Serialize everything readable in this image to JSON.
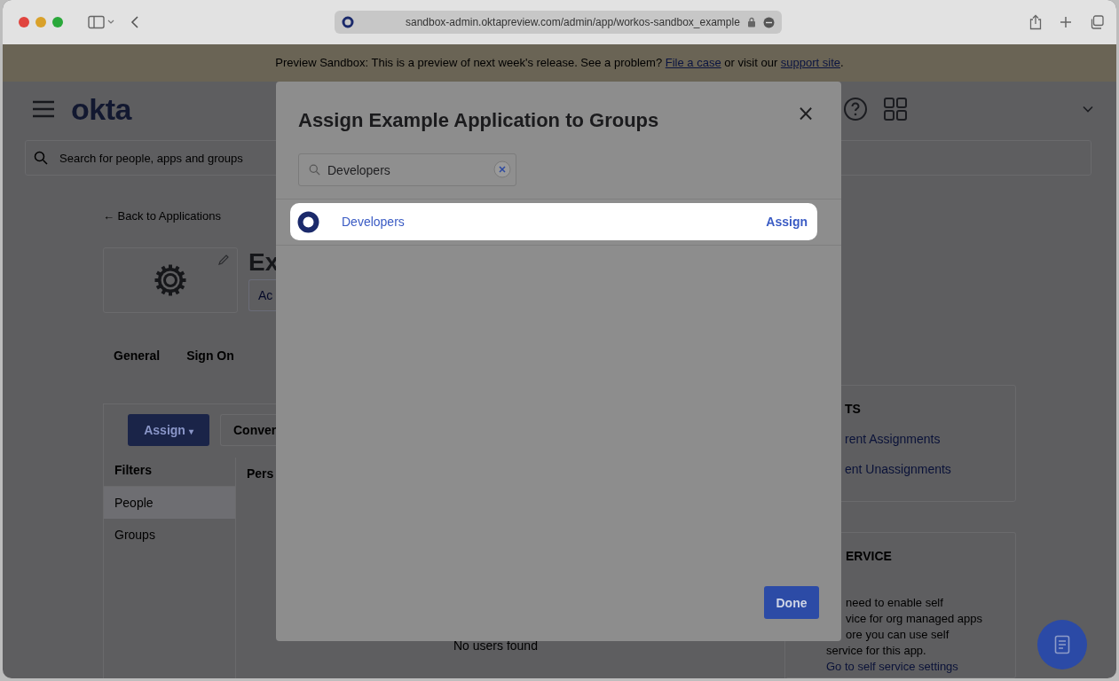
{
  "browser": {
    "url": "sandbox-admin.oktapreview.com/admin/app/workos-sandbox_example"
  },
  "banner": {
    "parts": [
      {
        "kind": "text",
        "text": "Preview Sandbox: This is a preview of next week's release. See a problem? "
      },
      {
        "kind": "link",
        "text": "File a case"
      },
      {
        "kind": "text",
        "text": " or visit our "
      },
      {
        "kind": "link",
        "text": "support site"
      },
      {
        "kind": "text",
        "text": "."
      }
    ]
  },
  "header": {
    "logo": "okta",
    "search_placeholder": "Search for people, apps and groups"
  },
  "app": {
    "back_link": "← Back to Applications",
    "title": "Ex",
    "status_button": "Ac"
  },
  "tabs": [
    {
      "label": "General",
      "selected": false
    },
    {
      "label": "Sign On",
      "selected": false
    }
  ],
  "assignments": {
    "assign_button": "Assign",
    "assign_caret": "▾",
    "convert_button": "Conver",
    "filters_heading": "Filters",
    "filters": [
      {
        "label": "People",
        "selected": true
      },
      {
        "label": "Groups",
        "selected": false
      }
    ],
    "column_1": "Pers",
    "empty_text": "No users found"
  },
  "reports": {
    "heading": "TS",
    "links": [
      "rent Assignments",
      "ent Unassignments"
    ]
  },
  "self_service": {
    "heading": "ERVICE",
    "lines": [
      {
        "text": "need to enable self",
        "cut": true
      },
      {
        "text": "vice for org managed apps",
        "cut": true
      },
      {
        "text": "ore you can use self",
        "cut": true
      },
      {
        "text": "service for this app.",
        "cut": false
      }
    ],
    "link": "Go to self service settings"
  },
  "modal": {
    "title": "Assign Example Application to Groups",
    "close": "×",
    "search_value": "Developers",
    "results": [
      {
        "name": "Developers",
        "action": "Assign",
        "highlighted": true
      }
    ],
    "done_button": "Done"
  }
}
